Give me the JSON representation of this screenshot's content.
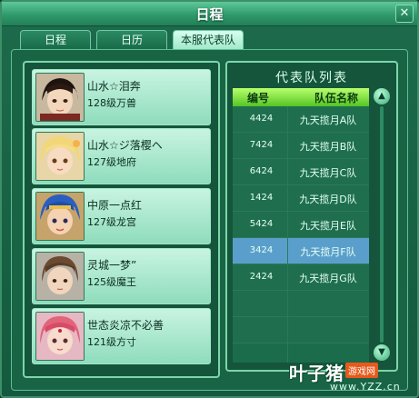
{
  "window": {
    "title": "日程",
    "close_glyph": "✕"
  },
  "tabs": [
    {
      "label": "日程",
      "active": false
    },
    {
      "label": "日历",
      "active": false
    },
    {
      "label": "本服代表队",
      "active": true
    }
  ],
  "players": [
    {
      "name": "山水☆泪奔",
      "level": "128级万兽",
      "avatar": "warrior-avatar"
    },
    {
      "name": "山水☆ジ落樱ヘ",
      "level": "127级地府",
      "avatar": "blonde-avatar"
    },
    {
      "name": "中原一点红",
      "level": "127级龙宫",
      "avatar": "blue-hair-avatar"
    },
    {
      "name": "灵城一梦”",
      "level": "125级魔王",
      "avatar": "brown-hair-avatar"
    },
    {
      "name": "世态炎凉不必善",
      "level": "121级方寸",
      "avatar": "pink-hair-avatar"
    }
  ],
  "team_list": {
    "title": "代表队列表",
    "headers": {
      "number": "编号",
      "team_name": "队伍名称"
    },
    "rows": [
      {
        "number": "4424",
        "team": "九天揽月A队"
      },
      {
        "number": "7424",
        "team": "九天揽月B队"
      },
      {
        "number": "6424",
        "team": "九天揽月C队"
      },
      {
        "number": "1424",
        "team": "九天揽月D队"
      },
      {
        "number": "5424",
        "team": "九天揽月E队"
      },
      {
        "number": "3424",
        "team": "九天揽月F队",
        "selected": true
      },
      {
        "number": "2424",
        "team": "九天揽月G队"
      }
    ]
  },
  "watermark": {
    "logo": "叶子猪",
    "sub": "游戏网",
    "url": "www.YZZ.cn"
  },
  "colors": {
    "accent": "#2f9a6c",
    "selected_row": "#5a9fcb",
    "header": "#55c524"
  }
}
